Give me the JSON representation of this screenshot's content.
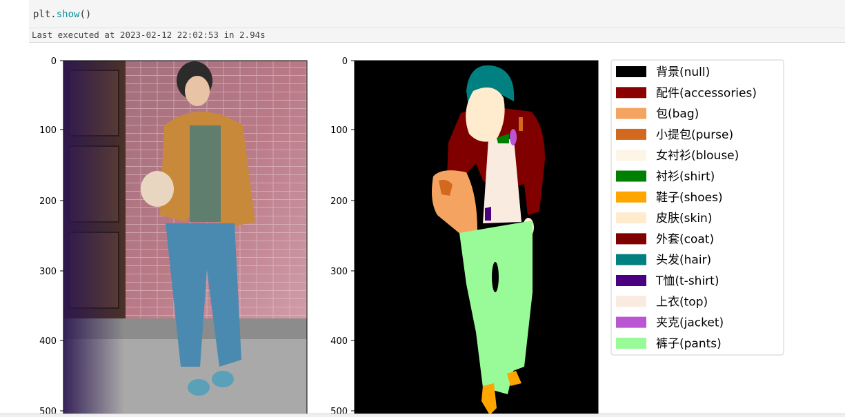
{
  "cell": {
    "code_object": "plt.",
    "code_call": "show",
    "code_parens": "()",
    "exec_status": "Last executed at 2023-02-12 22:02:53 in 2.94s"
  },
  "colors": {
    "code_function": "#0a8f9a",
    "cell_background": "#f5f5f5"
  },
  "figure": {
    "left_image": {
      "description_icon": "photo",
      "y_ticks": [
        "0",
        "100",
        "200",
        "300",
        "400",
        "500"
      ]
    },
    "right_image": {
      "description_icon": "segmentation-mask",
      "y_ticks": [
        "0",
        "100",
        "200",
        "300",
        "400",
        "500"
      ]
    },
    "legend": [
      {
        "label": "背景(null)",
        "color": "#000000"
      },
      {
        "label": "配件(accessories)",
        "color": "#8b0000"
      },
      {
        "label": "包(bag)",
        "color": "#f4a460"
      },
      {
        "label": "小提包(purse)",
        "color": "#d2691e"
      },
      {
        "label": "女衬衫(blouse)",
        "color": "#fdf5e6"
      },
      {
        "label": "衬衫(shirt)",
        "color": "#008000"
      },
      {
        "label": "鞋子(shoes)",
        "color": "#ffa500"
      },
      {
        "label": "皮肤(skin)",
        "color": "#ffebcd"
      },
      {
        "label": "外套(coat)",
        "color": "#800000"
      },
      {
        "label": "头发(hair)",
        "color": "#008080"
      },
      {
        "label": "T恤(t-shirt)",
        "color": "#4b0082"
      },
      {
        "label": "上衣(top)",
        "color": "#faebe1"
      },
      {
        "label": "夹克(jacket)",
        "color": "#ba55d3"
      },
      {
        "label": "裤子(pants)",
        "color": "#98fb98"
      }
    ]
  }
}
